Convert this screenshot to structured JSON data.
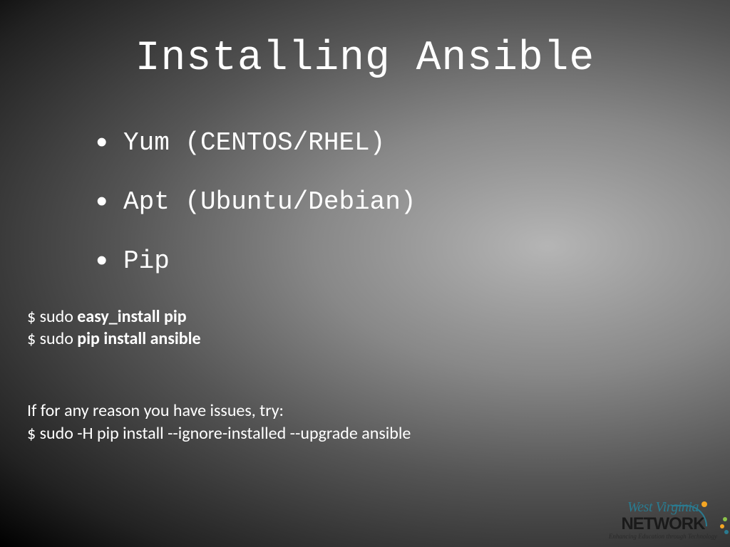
{
  "title": "Installing Ansible",
  "bullets": {
    "items": [
      "Yum (CENTOS/RHEL)",
      "Apt (Ubuntu/Debian)",
      "Pip"
    ]
  },
  "commands": {
    "line1_prefix": "$ sudo ",
    "line1_bold": "easy_install pip",
    "line2_prefix": "$ sudo ",
    "line2_bold": "pip install ansible"
  },
  "troubleshoot": {
    "intro": "If for any reason you have issues, try:",
    "cmd": "$ sudo -H pip install --ignore-installed --upgrade ansible"
  },
  "logo": {
    "top": "West Virginia",
    "main": "NETWORK",
    "tag": "Enhancing Education through Technology"
  }
}
